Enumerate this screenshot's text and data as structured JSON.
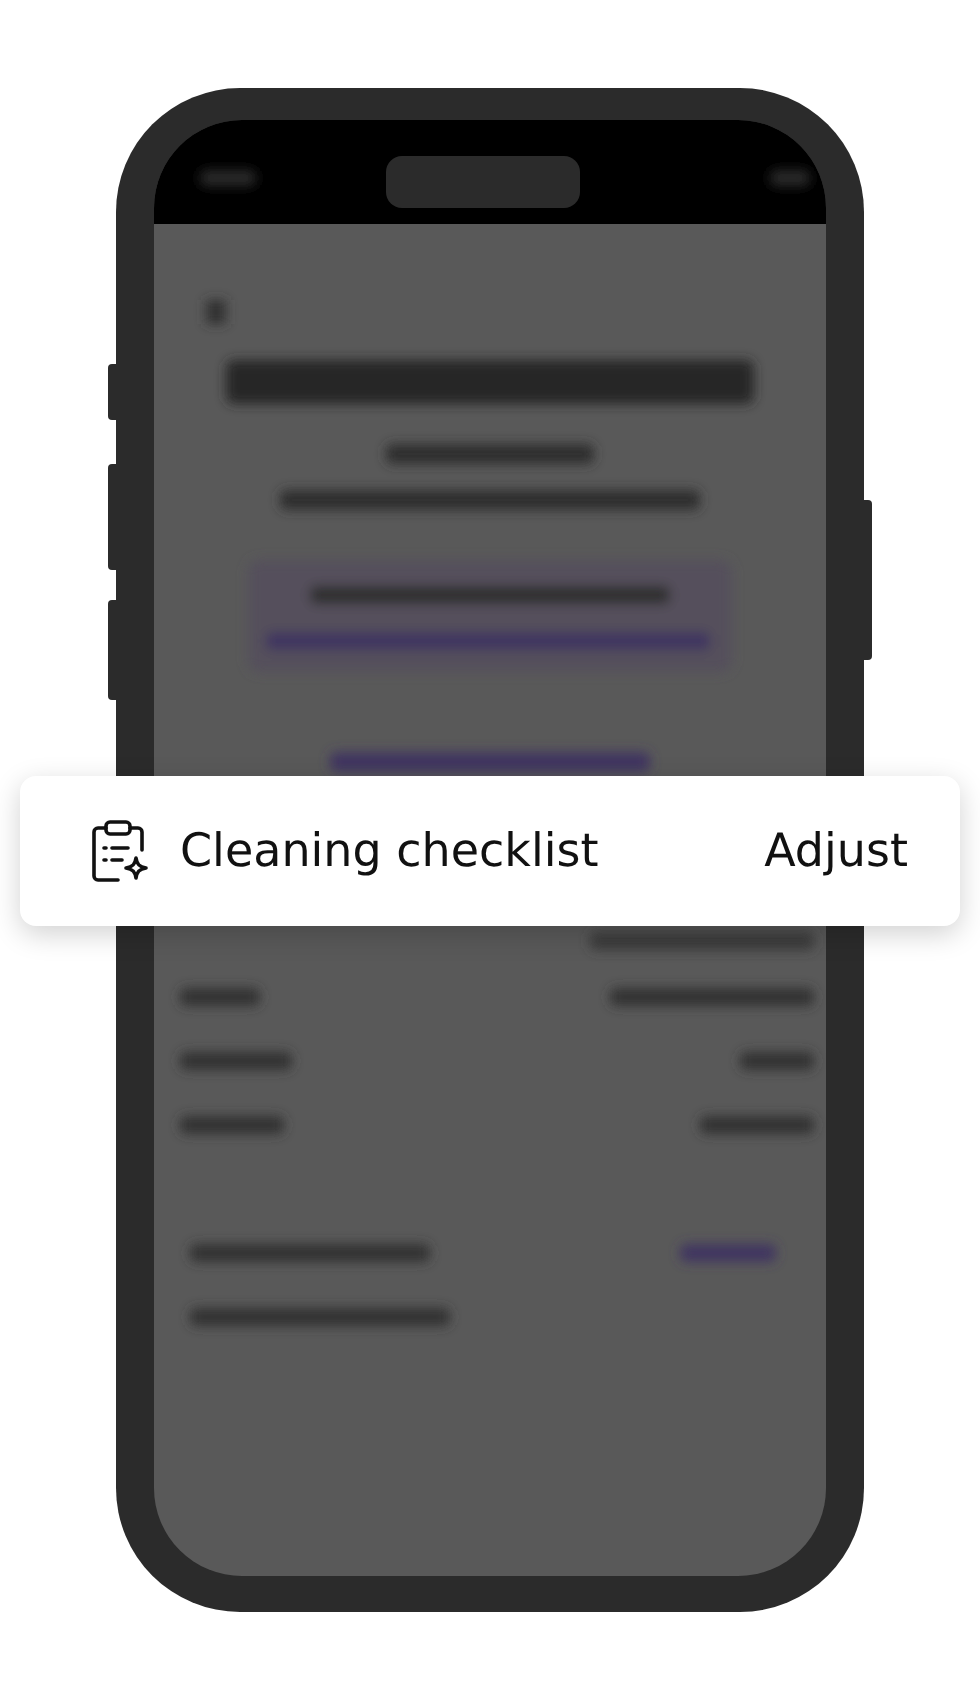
{
  "card": {
    "title": "Cleaning checklist",
    "action": "Adjust"
  }
}
